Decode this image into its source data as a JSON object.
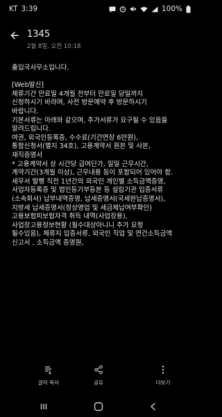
{
  "status_bar": {
    "carrier": "KT",
    "time": "3:39",
    "battery": "100%",
    "icons": [
      "message-icon",
      "alarm-icon",
      "mute-icon",
      "wifi-icon",
      "signal-icon",
      "battery-icon"
    ]
  },
  "header": {
    "sender": "1345",
    "date": "2월 8일, 오전 10:18"
  },
  "message": {
    "lines": [
      "출입국사무소입니다.",
      "",
      "[Web발신]",
      "체류기간 만료일 4개월 전부터 만료일 당일까지",
      "신청하시기 바라며, 사전 방문예약 후 방문하시기",
      "바랍니다.",
      "기본서류는 아래와 같으며, 추가서류가 요구될 수 있음을",
      "알려드립니다.",
      "여권, 외국인등록증, 수수료(기간연장 6만원),",
      "통합신청서(별지 34호), 고용계약서 원본 및 사본,",
      "재직증명서",
      "* 고용계약서 상 시간당 급여단가, 일일 근무시간,",
      "계약기간(3개월 이상), 근무내용 등이 포함되어 있어야 함.",
      "세무서 발행 직전 1년간의 외국인 개인별 소득금액증명,",
      "사업자등록증 및 법인등기부등본 등 설립기관 입증서류",
      "(소속회사) 납부내역증명, 납세증명서(국세완납증명서),",
      "지방세 납세증명서(정상영업 및 세금체납여부확인)",
      "고용보험피보험자격 취득 내역(사업장용),",
      "사업장고용정보현황 (필수대상아니니 추가 요청",
      "될수있음), 체류지 입증서류, 외국인 직업 및 연간소득금액",
      "신고서 , 소득금액 증명원,"
    ]
  },
  "actions": {
    "copy_label": "글자 복사",
    "share_label": "공유",
    "more_label": "더보기"
  },
  "colors": {
    "background": "#000000",
    "text": "#e4e4e4",
    "secondary": "#9a9a9a"
  }
}
